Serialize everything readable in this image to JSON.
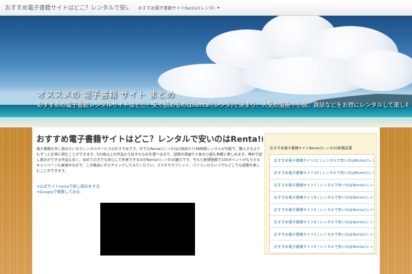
{
  "navbar": {
    "brand": "おすすめ電子書籍サイトはどこ？レンタルで安いのはRenta!(レンタ)",
    "menu_label": "おすすめ電子書籍サイトRenta!(レンタ)"
  },
  "hero": {
    "title": "オススメの 電子書籍 サイト まとめ",
    "subtitle": "おすすめの電子書籍レンタルサイトはどこ？安く読めるのはRenta!(レンタ)で決まり！人気の漫画や小説、雑誌などをお得にレンタルして楽しむ方法を紹介しています。"
  },
  "post": {
    "title": "おすすめ電子書籍サイトはどこ？レンタルで安いのはRenta!(レンタ)",
    "body": "電子書籍を安く読みたいならレンタルサービスがおすすめです。中でもRenta!(レンタ)は1冊あたり48時間レンタルが可能で、購入するよりもずっとお得に読むことができます。5万冊以上の作品から好きなものを選べるので、話題の漫画や人気の小説も気軽に楽しめます。無料で試し読みができる作品も多く、初めての方でも安心して利用できるのがRenta!(レンタ)の魅力です。今なら新規登録で100ポイントがもらえるキャンペーンも実施中なので、この機会にぜひチェックしてみてください。スマホやタブレット、パソコンからいつでもどこでも読書を楽しむことができます。",
    "links": [
      "⇒公式サイトrentaで試し読みをする",
      "⇒Googleで検索してみる."
    ]
  },
  "sidebar": {
    "heading": "おすすめ電子書籍サイトRenta!(レンタ)の新着記事",
    "items": [
      "おすすめ電子書籍サイト11 | レンタルで安いのはRenta!(レンタ)",
      "おすすめ電子書籍サイト10 | レンタルで安いのはRenta!(レンタ)",
      "おすすめ電子書籍サイト7 | レンタルで安いのはRenta!(レンタ)",
      "おすすめ電子書籍サイト8 | レンタルで安いのはRenta!(レンタ)",
      "おすすめ電子書籍サイト5 | レンタルで安いのはRenta!(レンタ)",
      "おすすめ電子書籍サイト6 | レンタルで安いのはRenta!(レンタ)",
      "おすすめ電子書籍サイト3 | レンタルで安いのはRenta!(レンタ)",
      "おすすめ電子書籍サイト4 | レンタルで安いのはRenta!(レンタ)"
    ]
  },
  "colors": {
    "link": "#2c6fa8",
    "sidebar_bg": "#fbf4d8",
    "wood": "#d09848"
  }
}
